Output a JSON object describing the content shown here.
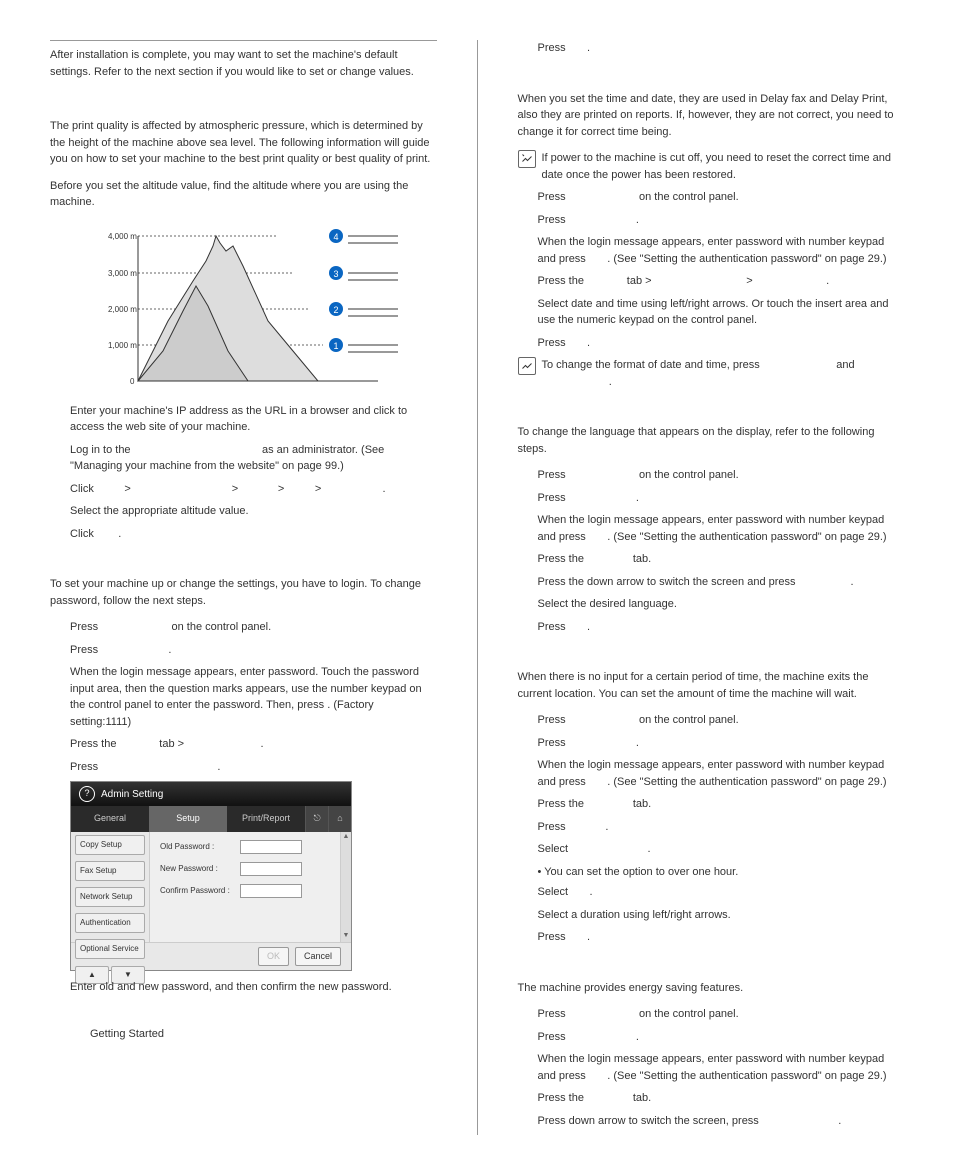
{
  "left": {
    "intro1": "After installation is complete, you may want to set the machine's default settings. Refer to the next section if you would like to set or change values.",
    "intro2": "The print quality is affected by atmospheric pressure, which is determined by the height of the machine above sea level. The following information will guide you on how to set your machine to the best print quality or best quality of print.",
    "intro3": "Before you set the altitude value, find the altitude where you are using the machine.",
    "altitude_labels": [
      "4,000 m",
      "3,000 m",
      "2,000 m",
      "1,000 m",
      "0"
    ],
    "s1": "Enter your machine's IP address as the URL in a browser and click to access the web site of your machine.",
    "s2a": "Log in to the",
    "s2b": "as an administrator. (See \"Managing your machine from the website\" on page 99.)",
    "s3a": "Click",
    "s3b": ">",
    "s3c": ">",
    "s3d": ">",
    "s3e": ">",
    "s3f": ".",
    "s4": "Select the appropriate altitude value.",
    "s5a": "Click",
    "s5b": ".",
    "auth_intro": "To set your machine up or change the settings, you have to login. To change password, follow the next steps.",
    "a1a": "Press",
    "a1b": "on the control panel.",
    "a2a": "Press",
    "a2b": ".",
    "a3": "When the login message appears, enter password. Touch the password input area, then the question marks appears, use the number keypad on the control panel to enter the password. Then, press        . (Factory setting:1111)",
    "a4a": "Press the",
    "a4b": "tab >",
    "a4c": ".",
    "a5a": "Press",
    "a5b": ".",
    "admin_title": "Admin Setting",
    "admin_tabs": [
      "General",
      "Setup",
      "Print/Report"
    ],
    "admin_side": [
      "Copy Setup",
      "Fax Setup",
      "Network Setup",
      "Authentication",
      "Optional Service"
    ],
    "admin_rows": [
      "Old Password :",
      "New Password :",
      "Confirm Password :"
    ],
    "admin_ok": "OK",
    "admin_cancel": "Cancel",
    "confirm": "Enter old and new password, and then confirm the new password."
  },
  "right": {
    "r0a": "Press",
    "r0b": ".",
    "date_intro": "When you set the time and date, they are used in Delay fax and Delay Print, also they are printed on reports. If, however, they are not correct, you need to change it for correct time being.",
    "note1": "If power to the machine is cut off, you need to reset the correct time and date once the power has been restored.",
    "d1a": "Press",
    "d1b": "on the control panel.",
    "d2a": "Press",
    "d2b": ".",
    "d3a": "When the login message appears, enter password with number keypad and press",
    "d3b": ". (See \"Setting the authentication password\" on page 29.)",
    "d4a": "Press the",
    "d4b": "tab >",
    "d4c": ">",
    "d4d": ".",
    "d5": "Select date and time using left/right arrows. Or touch the insert area and use the numeric keypad on the control panel.",
    "d6a": "Press",
    "d6b": ".",
    "note2a": "To change the format of date and time, press",
    "note2b": "and",
    "note2c": ".",
    "lang_intro": "To change the language that appears on the display, refer to the following steps.",
    "l1a": "Press",
    "l1b": "on the control panel.",
    "l2a": "Press",
    "l2b": ".",
    "l3a": "When the login message appears, enter password with number keypad and press",
    "l3b": ". (See \"Setting the authentication password\" on page 29.)",
    "l4a": "Press the",
    "l4b": "tab.",
    "l5a": "Press the down arrow to switch the screen and press",
    "l5b": ".",
    "l6": "Select the desired language.",
    "l7a": "Press",
    "l7b": ".",
    "timeout_intro": "When there is no input for a certain period of time, the machine exits the current location. You can set the amount of time the machine will wait.",
    "t1a": "Press",
    "t1b": "on the control panel.",
    "t2a": "Press",
    "t2b": ".",
    "t3a": "When the login message appears, enter password with number keypad and press",
    "t3b": ". (See \"Setting the authentication password\" on page 29.)",
    "t4a": "Press the",
    "t4b": "tab.",
    "t5a": "Press",
    "t5b": ".",
    "t6a": "Select",
    "t6b": ".",
    "t6s": "• You can set the                              option to over one hour.",
    "t7a": "Select",
    "t7b": ".",
    "t8": "Select a duration using left/right arrows.",
    "t9a": "Press",
    "t9b": ".",
    "energy_intro": "The machine provides energy saving features.",
    "e1a": "Press",
    "e1b": "on the control panel.",
    "e2a": "Press",
    "e2b": ".",
    "e3a": "When the login message appears, enter password with number keypad and press",
    "e3b": ". (See \"Setting the authentication password\" on page 29.)",
    "e4a": "Press the",
    "e4b": "tab.",
    "e5a": "Press down arrow to switch the screen, press",
    "e5b": "."
  },
  "footer": "Getting Started"
}
